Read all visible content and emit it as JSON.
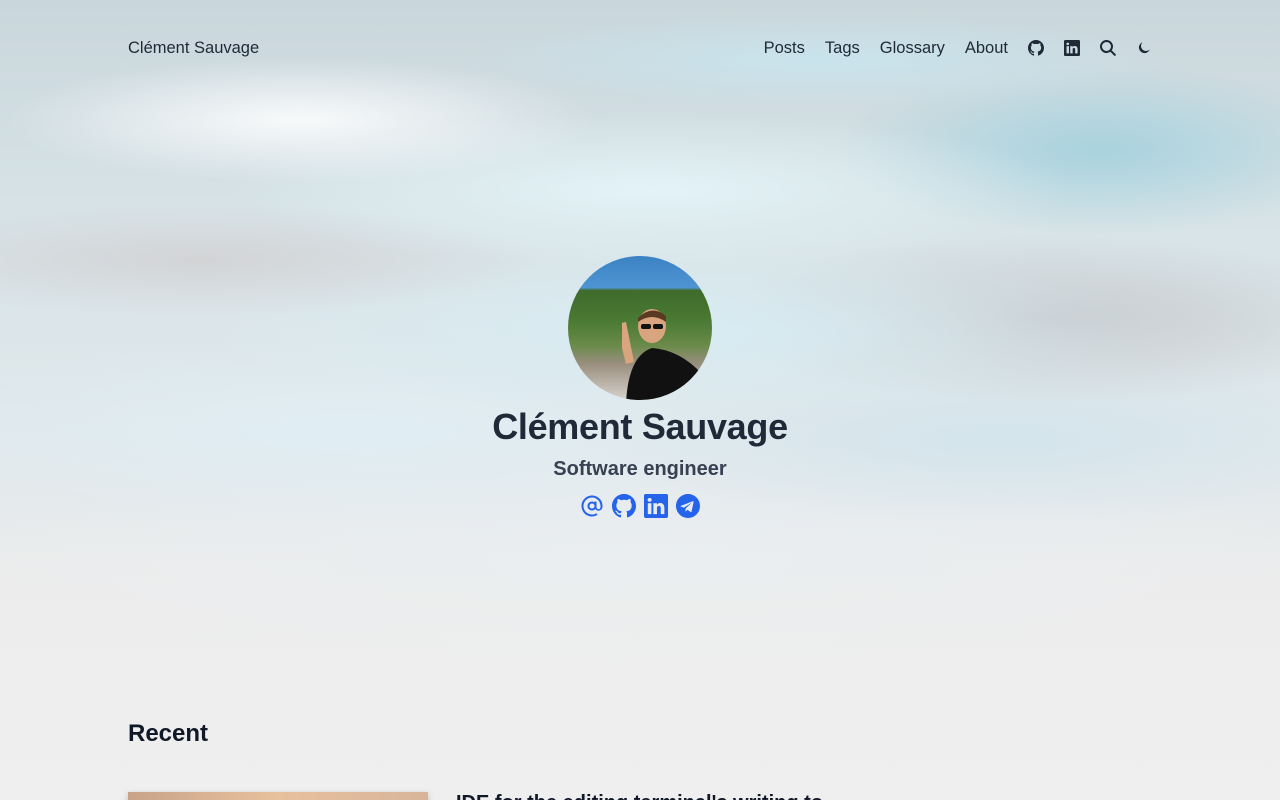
{
  "header": {
    "brand": "Clément Sauvage",
    "nav": [
      "Posts",
      "Tags",
      "Glossary",
      "About"
    ],
    "icons": [
      "github-icon",
      "linkedin-icon",
      "search-icon",
      "moon-icon"
    ]
  },
  "hero": {
    "name": "Clément Sauvage",
    "tagline": "Software engineer",
    "socials": [
      "email-icon",
      "github-icon",
      "linkedin-icon",
      "telegram-icon"
    ],
    "accent_color": "#2563eb"
  },
  "recent": {
    "heading": "Recent",
    "first_post_title": "IDE for the editing terminal's writing to"
  }
}
